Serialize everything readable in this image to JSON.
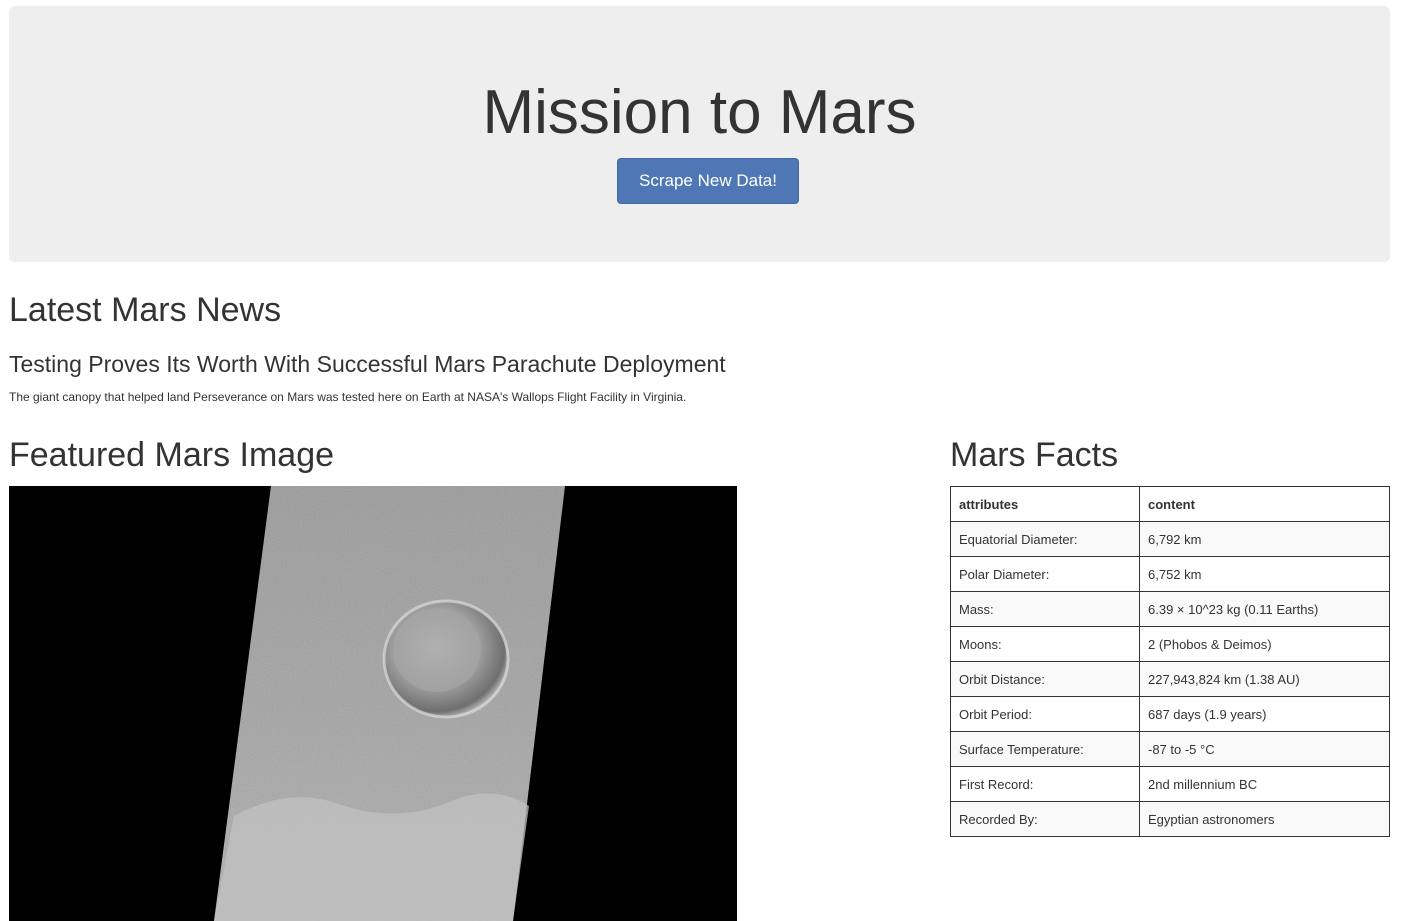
{
  "header": {
    "title": "Mission to Mars",
    "button_label": "Scrape New Data!"
  },
  "news": {
    "heading": "Latest Mars News",
    "title": "Testing Proves Its Worth With Successful Mars Parachute Deployment",
    "paragraph": "The giant canopy that helped land Perseverance on Mars was tested here on Earth at NASA's Wallops Flight Facility in Virginia."
  },
  "featured_image": {
    "heading": "Featured Mars Image"
  },
  "facts": {
    "heading": "Mars Facts",
    "columns": [
      "attributes",
      "content"
    ],
    "rows": [
      [
        "Equatorial Diameter:",
        "6,792 km"
      ],
      [
        "Polar Diameter:",
        "6,752 km"
      ],
      [
        "Mass:",
        "6.39 × 10^23 kg (0.11 Earths)"
      ],
      [
        "Moons:",
        "2 (Phobos & Deimos)"
      ],
      [
        "Orbit Distance:",
        "227,943,824 km (1.38 AU)"
      ],
      [
        "Orbit Period:",
        "687 days (1.9 years)"
      ],
      [
        "Surface Temperature:",
        "-87 to -5 °C"
      ],
      [
        "First Record:",
        "2nd millennium BC"
      ],
      [
        "Recorded By:",
        "Egyptian astronomers"
      ]
    ]
  },
  "colors": {
    "jumbotron_bg": "#eeeeee",
    "button_bg": "#4f77b6",
    "text": "#333333"
  }
}
